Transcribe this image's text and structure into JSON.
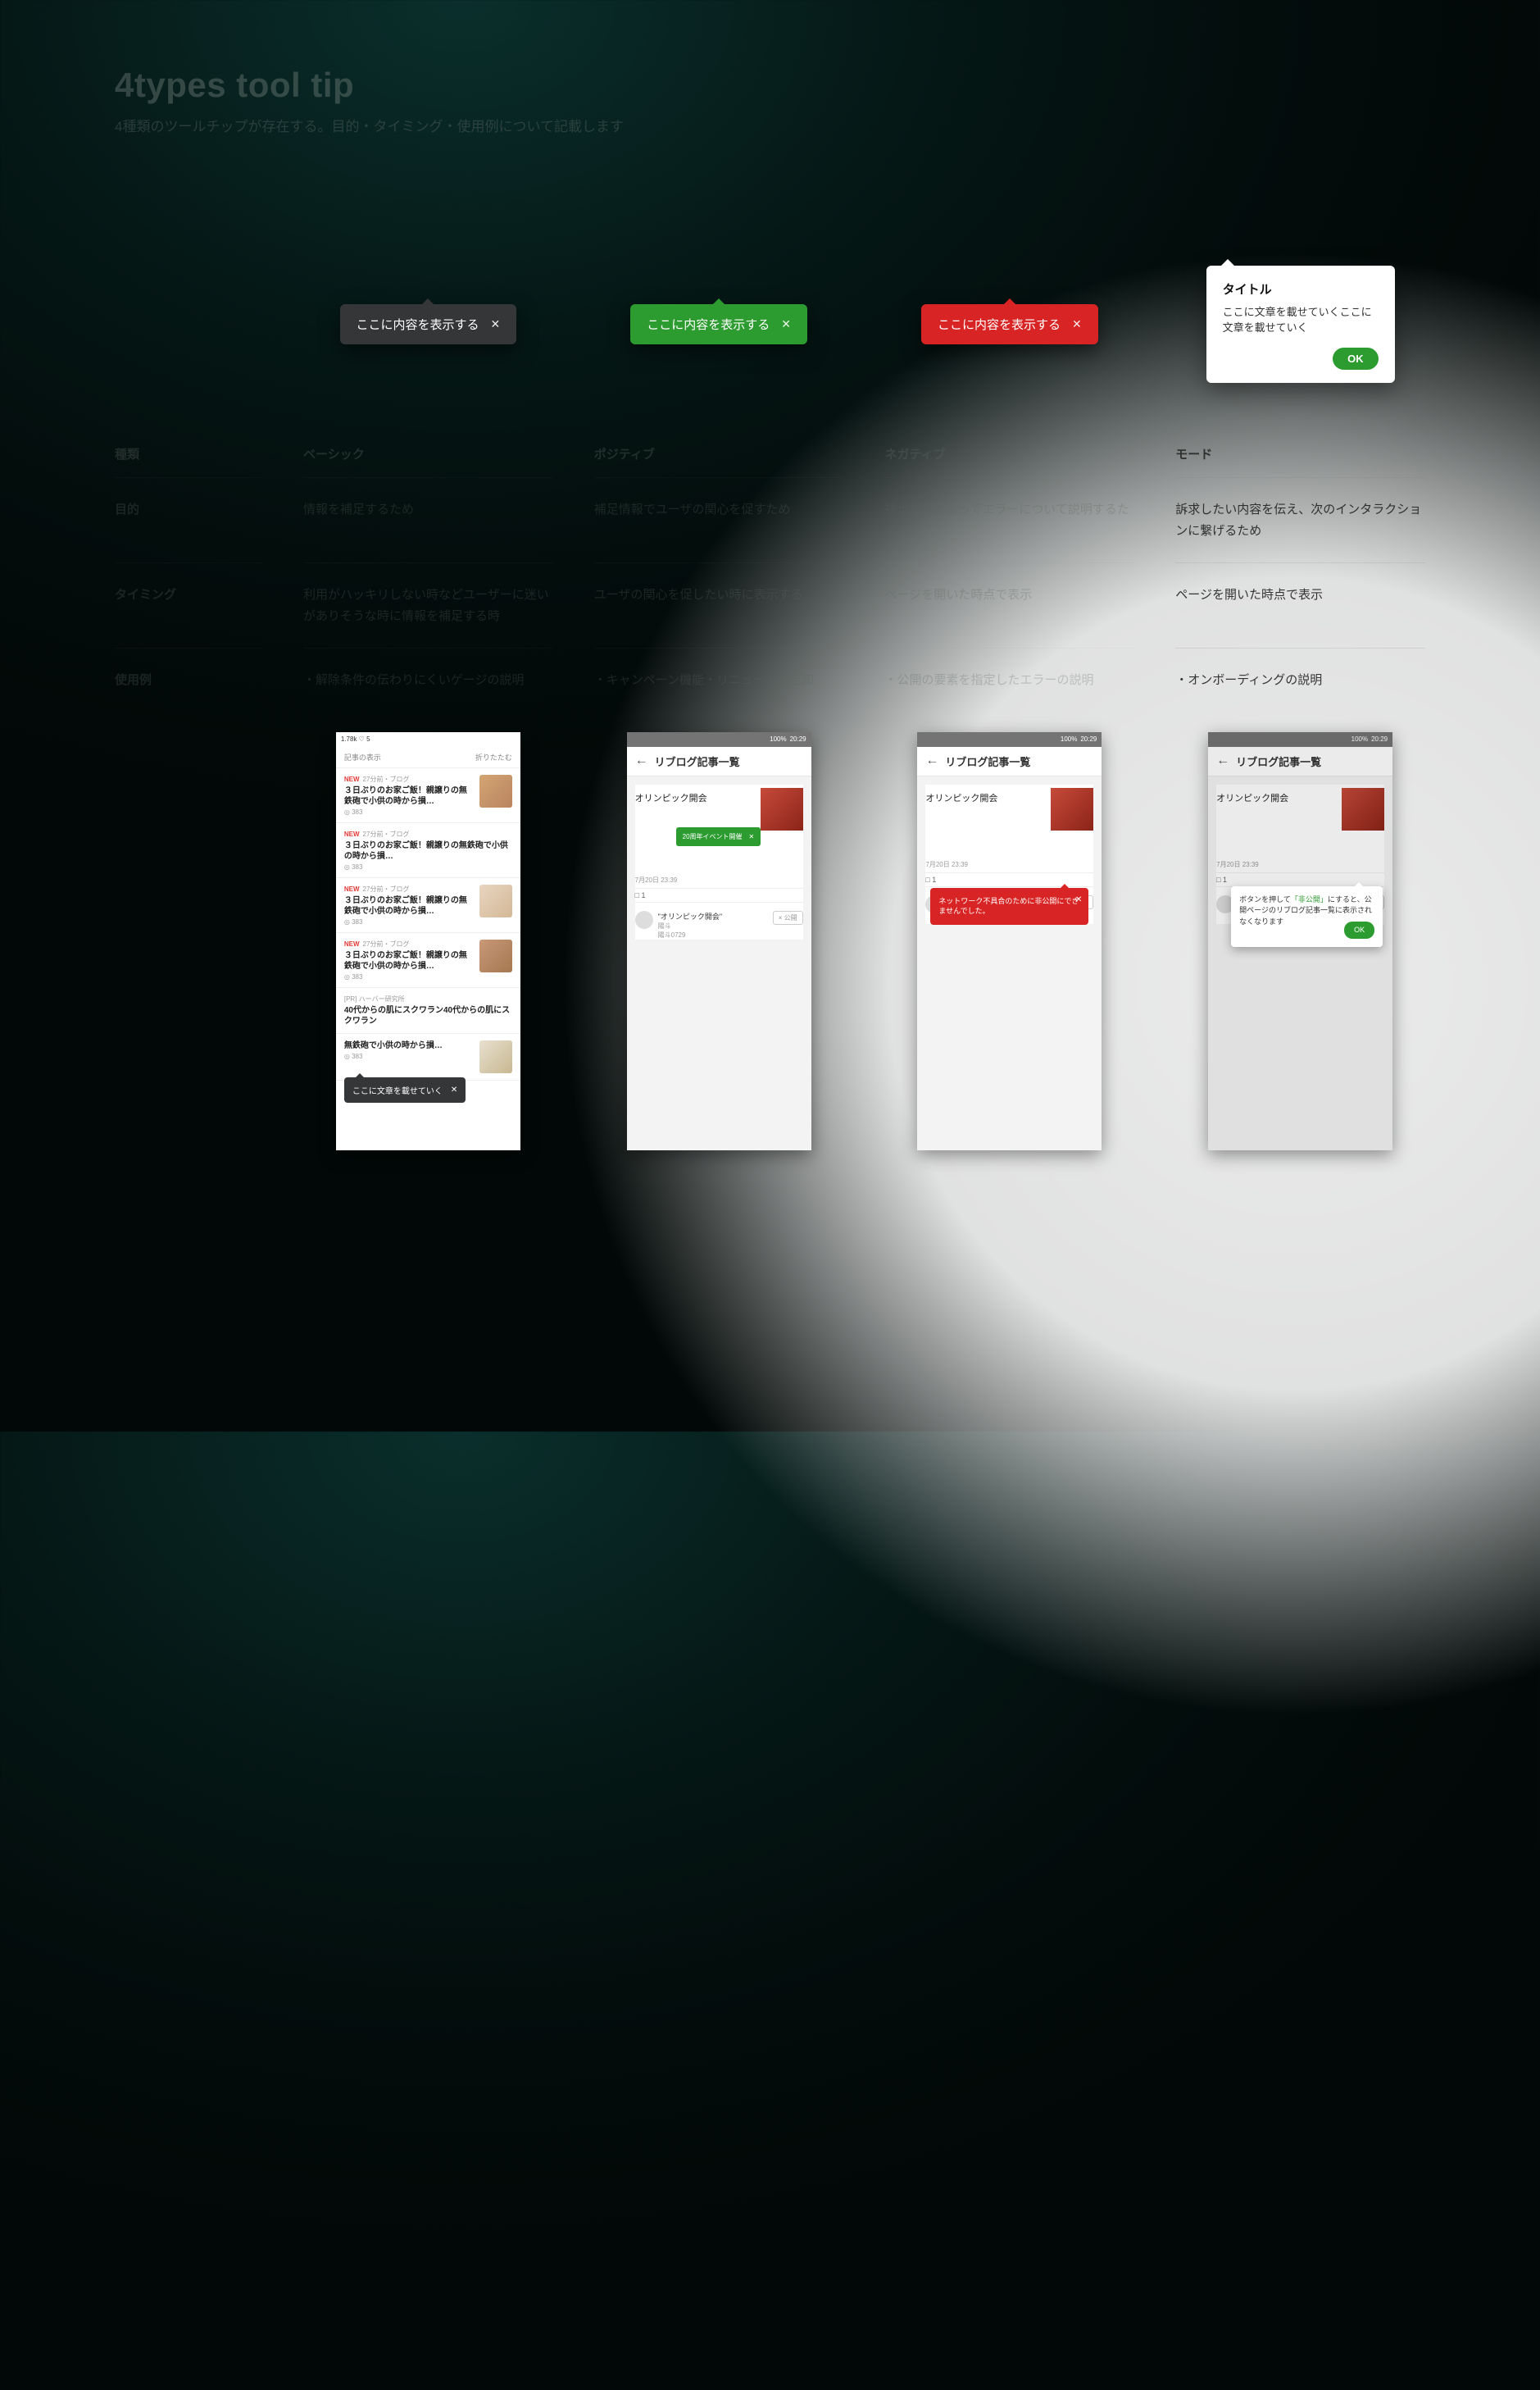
{
  "header": {
    "title": "4types tool tip",
    "subtitle": "4種類のツールチップが存在する。目的・タイミング・使用例について記載します"
  },
  "rows": {
    "type": {
      "label": "種類",
      "c1": "ベーシック",
      "c2": "ポジティブ",
      "c3": "ネガティブ",
      "c4": "モード"
    },
    "purpose": {
      "label": "目的",
      "c1": "情報を補足するため",
      "c2": "補足情報でユーザの関心を促すため",
      "c3": "補足情報によってエラーについて説明するため",
      "c4": "訴求したい内容を伝え、次のインタラクションに繋げるため"
    },
    "timing": {
      "label": "タイミング",
      "c1": "利用がハッキリしない時などユーザーに迷いがありそうな時に情報を補足する時",
      "c2": "ユーザの関心を促したい時に表示する",
      "c3": "ページを開いた時点で表示",
      "c4": "ページを開いた時点で表示"
    },
    "usage": {
      "label": "使用例",
      "c1": "・解除条件の伝わりにくいゲージの説明",
      "c2": "・キャンペーン機能・リニューアル告知",
      "c3": "・公開の要素を指定したエラーの説明",
      "c4": "・オンボーディングの説明"
    }
  },
  "tooltips": {
    "text": "ここに内容を表示する",
    "card": {
      "title": "タイトル",
      "body": "ここに文章を載せていくここに文章を載せていく",
      "ok": "OK"
    }
  },
  "phone": {
    "status": {
      "left": "1.78k  ♡ 5",
      "time": "20:29",
      "batt": "100%"
    },
    "feed": {
      "tabs": {
        "l": "記事の表示",
        "r": "折りたたむ"
      },
      "items": [
        {
          "new": "NEW",
          "meta": "27分前・ブログ",
          "title": "３日ぶりのお家ご飯！親譲りの無鉄砲で小供の時から損…",
          "views": "◎ 383"
        },
        {
          "new": "NEW",
          "meta": "27分前・ブログ",
          "title": "３日ぶりのお家ご飯！親譲りの無鉄砲で小供の時から損…",
          "views": "◎ 383"
        },
        {
          "new": "NEW",
          "meta": "27分前・ブログ",
          "title": "３日ぶりのお家ご飯！親譲りの無鉄砲で小供の時から損…",
          "views": "◎ 383"
        },
        {
          "new": "NEW",
          "meta": "27分前・ブログ",
          "title": "３日ぶりのお家ご飯！親譲りの無鉄砲で小供の時から損…",
          "views": "◎ 383"
        },
        {
          "new": "",
          "meta": "[PR] ハーバー研究所",
          "title": "40代からの肌にスクワラン40代からの肌にスクワラン",
          "views": ""
        },
        {
          "new": "",
          "meta": "",
          "title": "無鉄砲で小供の時から損…",
          "views": "◎ 383"
        }
      ],
      "overlay": "ここに文章を載せていく"
    },
    "reblog": {
      "appbar": "リブログ記事一覧",
      "post_title": "オリンピック開会",
      "date": "7月20日 23:39",
      "count": "□ 1",
      "quote": "\"オリンピック開会\"",
      "user": "陽斗",
      "usersub": "陽斗0729",
      "pub": "× 公開",
      "green": "20周年イベント開催",
      "red": "ネットワーク不具合のために非公開にできませんでした。",
      "mode": {
        "pre": "ボタンを押して",
        "hl": "「非公開」",
        "post": "にすると、公開ページのリブログ記事一覧に表示されなくなります",
        "ok": "OK"
      }
    }
  }
}
